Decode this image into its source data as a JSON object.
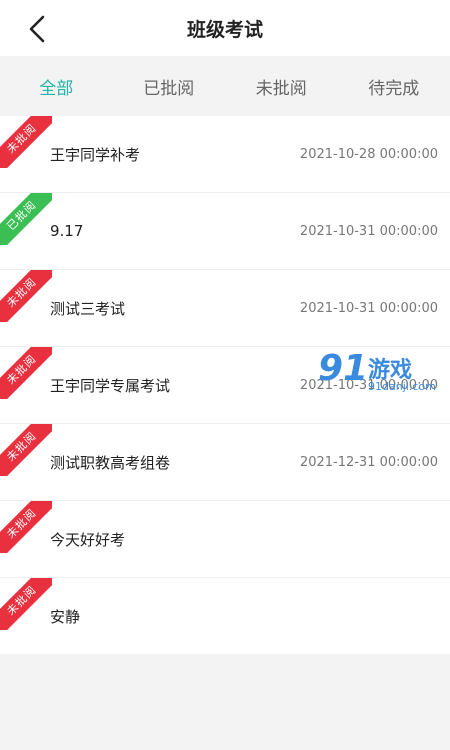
{
  "header": {
    "title": "班级考试",
    "back_icon": "chevron-left-icon"
  },
  "tabs": [
    {
      "label": "全部",
      "active": true
    },
    {
      "label": "已批阅",
      "active": false
    },
    {
      "label": "未批阅",
      "active": false
    },
    {
      "label": "待完成",
      "active": false
    }
  ],
  "colors": {
    "accent": "#22b3a8",
    "ribbon_red": "#e8303f",
    "ribbon_green": "#3bbf54"
  },
  "exams": [
    {
      "status": "未批阅",
      "title": "王宇同学补考",
      "date": "2021-10-28 00:00:00"
    },
    {
      "status": "已批阅",
      "title": "9.17",
      "date": "2021-10-31 00:00:00"
    },
    {
      "status": "未批阅",
      "title": "测试三考试",
      "date": "2021-10-31 00:00:00"
    },
    {
      "status": "未批阅",
      "title": "王宇同学专属考试",
      "date": "2021-10-31 00:00:00"
    },
    {
      "status": "未批阅",
      "title": "测试职教高考组卷",
      "date": "2021-12-31 00:00:00"
    },
    {
      "status": "未批阅",
      "title": "今天好好考",
      "date": ""
    },
    {
      "status": "未批阅",
      "title": "安静",
      "date": ""
    }
  ],
  "watermark": {
    "number": "91",
    "text": "游戏",
    "sub": "91danji.com"
  }
}
